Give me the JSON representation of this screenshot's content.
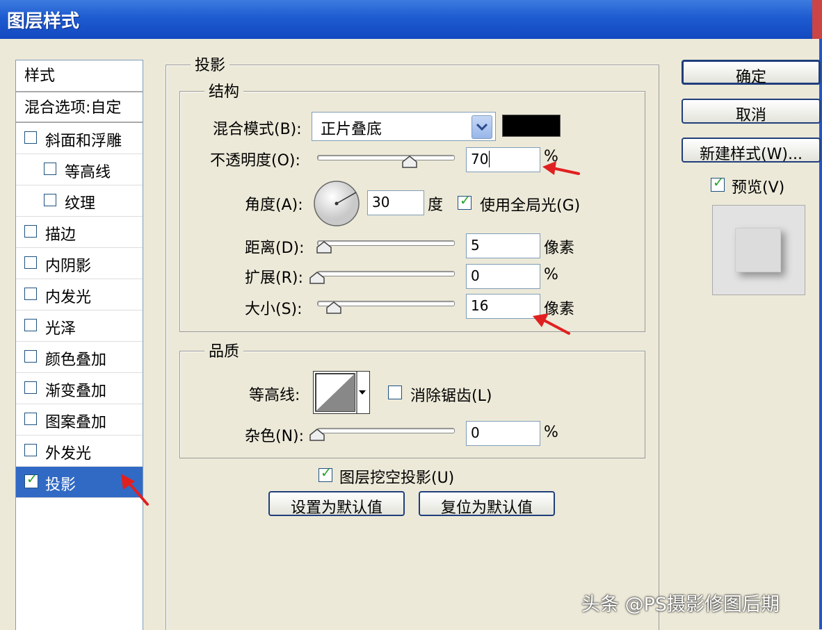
{
  "window": {
    "title": "图层样式"
  },
  "style_list": {
    "header": "样式",
    "blend_options": "混合选项:自定",
    "items": [
      {
        "label": "斜面和浮雕",
        "checked": false
      },
      {
        "label": "等高线",
        "checked": false
      },
      {
        "label": "纹理",
        "checked": false
      },
      {
        "label": "描边",
        "checked": false
      },
      {
        "label": "内阴影",
        "checked": false
      },
      {
        "label": "内发光",
        "checked": false
      },
      {
        "label": "光泽",
        "checked": false
      },
      {
        "label": "颜色叠加",
        "checked": false
      },
      {
        "label": "渐变叠加",
        "checked": false
      },
      {
        "label": "图案叠加",
        "checked": false
      },
      {
        "label": "外发光",
        "checked": false
      },
      {
        "label": "投影",
        "checked": true,
        "selected": true
      }
    ]
  },
  "panel": {
    "title": "投影",
    "structure": {
      "title": "结构",
      "blend_mode_label": "混合模式(B):",
      "blend_mode_value": "正片叠底",
      "blend_color": "#000000",
      "opacity_label": "不透明度(O):",
      "opacity_value": "70",
      "opacity_unit": "%",
      "opacity_fraction": 0.7,
      "angle_label": "角度(A):",
      "angle_value": "30",
      "angle_unit": "度",
      "global_light_label": "使用全局光(G)",
      "global_light_checked": true,
      "distance_label": "距离(D):",
      "distance_value": "5",
      "distance_unit": "像素",
      "spread_label": "扩展(R):",
      "spread_value": "0",
      "spread_unit": "%",
      "size_label": "大小(S):",
      "size_value": "16",
      "size_unit": "像素"
    },
    "quality": {
      "title": "品质",
      "contour_label": "等高线:",
      "anti_alias_label": "消除锯齿(L)",
      "anti_alias_checked": false,
      "noise_label": "杂色(N):",
      "noise_value": "0",
      "noise_unit": "%"
    },
    "knockout_label": "图层挖空投影(U)",
    "knockout_checked": true,
    "make_default_label": "设置为默认值",
    "reset_default_label": "复位为默认值"
  },
  "buttons": {
    "ok": "确定",
    "cancel": "取消",
    "new_style": "新建样式(W)...",
    "preview_label": "预览(V)",
    "preview_checked": true
  },
  "watermark": "头条 @PS摄影修图后期",
  "colors": {
    "title_bar": "#1E5BD0",
    "selection": "#316AC5",
    "annotation_arrow": "#E02020"
  }
}
